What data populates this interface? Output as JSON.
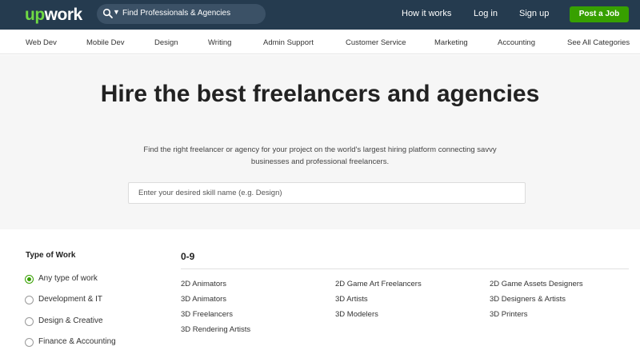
{
  "header": {
    "logo_up": "up",
    "logo_work": "work",
    "search_label": "Find Professionals & Agencies",
    "how_it_works": "How it works",
    "log_in": "Log in",
    "sign_up": "Sign up",
    "post_job": "Post a Job"
  },
  "categories": [
    "Web Dev",
    "Mobile Dev",
    "Design",
    "Writing",
    "Admin Support",
    "Customer Service",
    "Marketing",
    "Accounting",
    "See All Categories"
  ],
  "hero": {
    "title": "Hire the best freelancers and agencies",
    "subtitle": "Find the right freelancer or agency for your project on the world's largest hiring platform connecting savvy businesses and professional freelancers.",
    "skill_placeholder": "Enter your desired skill name (e.g. Design)"
  },
  "filters": {
    "title": "Type of Work",
    "options": [
      {
        "label": "Any type of work",
        "checked": true
      },
      {
        "label": "Development & IT",
        "checked": false
      },
      {
        "label": "Design & Creative",
        "checked": false
      },
      {
        "label": "Finance & Accounting",
        "checked": false
      }
    ]
  },
  "listing": {
    "heading": "0-9",
    "col1": [
      "2D Animators",
      "3D Animators",
      "3D Freelancers",
      "3D Rendering Artists"
    ],
    "col2": [
      "2D Game Art Freelancers",
      "3D Artists",
      "3D Modelers"
    ],
    "col3": [
      "2D Game Assets Designers",
      "3D Designers & Artists",
      "3D Printers"
    ]
  },
  "colors": {
    "header_bg": "#253b4f",
    "accent_green": "#37a000",
    "logo_green": "#6fda44",
    "hero_bg": "#f6f6f6"
  }
}
